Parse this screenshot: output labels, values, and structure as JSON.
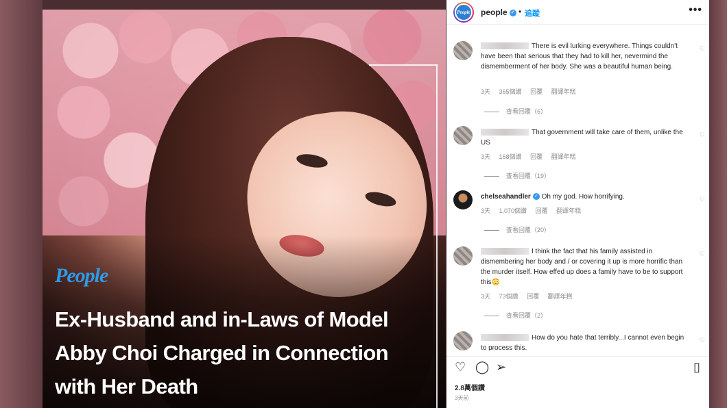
{
  "post": {
    "brand_logo": "People",
    "headline": "Ex-Husband and in-Laws of Model Abby Choi Charged in Connection with Her Death"
  },
  "header": {
    "avatar_text": "People",
    "username": "people",
    "verified_mark": "✓",
    "separator": "•",
    "follow_label": "追蹤",
    "more_icon": "•••"
  },
  "comments": [
    {
      "username": "",
      "text": "There is evil lurking everywhere. Things couldn't have been that serious that they had to kill her, nevermind the dismemberment of her body. She was a beautiful human being.",
      "time": "3天",
      "likes": "365個讚",
      "reply": "回覆",
      "translate": "翻譯年糕",
      "view_replies": "查看回覆（6）"
    },
    {
      "username": "",
      "text": "That government will take care of them, unlike the US",
      "time": "3天",
      "likes": "168個讚",
      "reply": "回覆",
      "translate": "翻譯年糕",
      "view_replies": "查看回覆（19）"
    },
    {
      "username": "chelseahandler",
      "text": "Oh my god. How horrifying.",
      "time": "3天",
      "likes": "1,070個讚",
      "reply": "回覆",
      "translate": "翻譯年糕",
      "view_replies": "查看回覆（20）"
    },
    {
      "username": "",
      "text": "I think the fact that his family assisted in dismembering her body and / or covering it up is more horrific than the murder itself. How effed up does a family have to be to support this😳",
      "time": "3天",
      "likes": "73個讚",
      "reply": "回覆",
      "translate": "翻譯年糕",
      "view_replies": "查看回覆（2）"
    },
    {
      "username": "",
      "text": "How do you hate that terribly...I cannot even begin to process this.",
      "time": "",
      "likes": "",
      "reply": "",
      "translate": "",
      "view_replies": ""
    }
  ],
  "icons": {
    "like": "heart-icon",
    "comment": "comment-icon",
    "share": "share-icon",
    "save": "bookmark-icon"
  },
  "footer": {
    "likes_count": "2.8萬個讚",
    "posted_ago": "3天前"
  }
}
